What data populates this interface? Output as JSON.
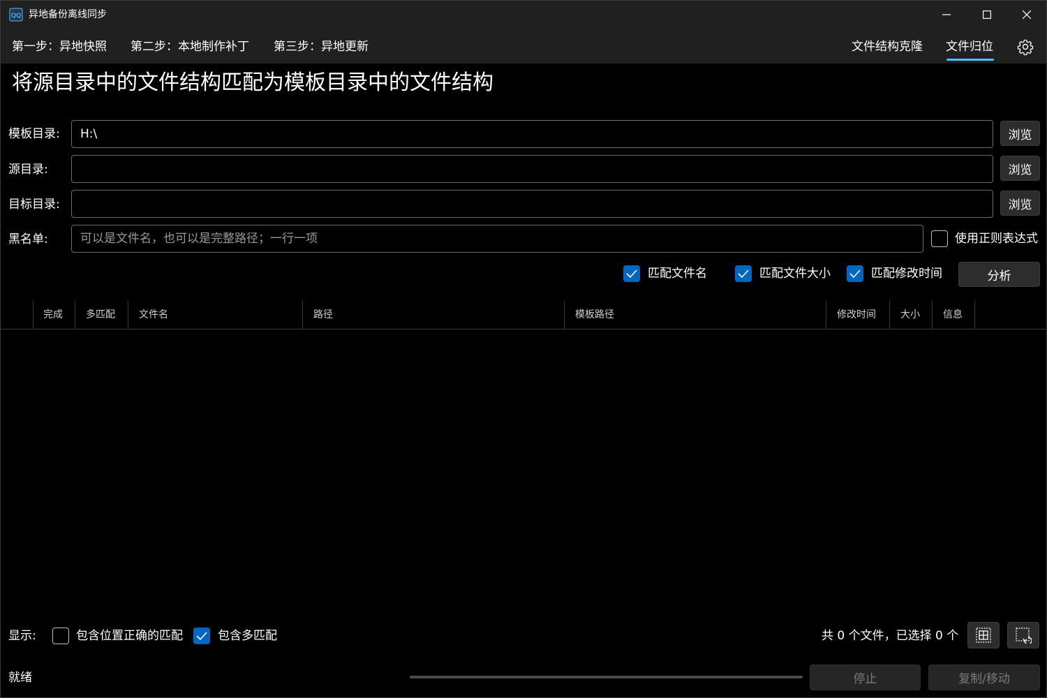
{
  "window": {
    "title": "异地备份离线同步"
  },
  "nav": {
    "step1": "第一步：异地快照",
    "step2": "第二步：本地制作补丁",
    "step3": "第三步：异地更新",
    "clone": "文件结构克隆",
    "relocate": "文件归位",
    "active": "文件归位"
  },
  "page": {
    "title": "将源目录中的文件结构匹配为模板目录中的文件结构"
  },
  "form": {
    "template_label": "模板目录:",
    "template_value": "H:\\",
    "source_label": "源目录:",
    "source_value": "",
    "target_label": "目标目录:",
    "target_value": "",
    "blacklist_label": "黑名单:",
    "blacklist_placeholder": "可以是文件名，也可以是完整路径；一行一项",
    "browse": "浏览",
    "regex_label": "使用正则表达式",
    "regex_checked": false
  },
  "options": {
    "match_name": "匹配文件名",
    "match_name_checked": true,
    "match_size": "匹配文件大小",
    "match_size_checked": true,
    "match_time": "匹配修改时间",
    "match_time_checked": true,
    "analyze": "分析"
  },
  "table": {
    "columns": [
      "完成",
      "多匹配",
      "文件名",
      "路径",
      "模板路径",
      "修改时间",
      "大小",
      "信息"
    ],
    "rows": []
  },
  "footer": {
    "show_label": "显示:",
    "include_correct": "包含位置正确的匹配",
    "include_correct_checked": false,
    "include_multi": "包含多匹配",
    "include_multi_checked": true,
    "summary": "共 0 个文件，已选择 0 个",
    "status": "就绪",
    "stop": "停止",
    "copy_move": "复制/移动"
  },
  "colors": {
    "accent": "#0067c0",
    "underline": "#4cc2ff",
    "titlebar": "#202020",
    "background": "#000000"
  }
}
